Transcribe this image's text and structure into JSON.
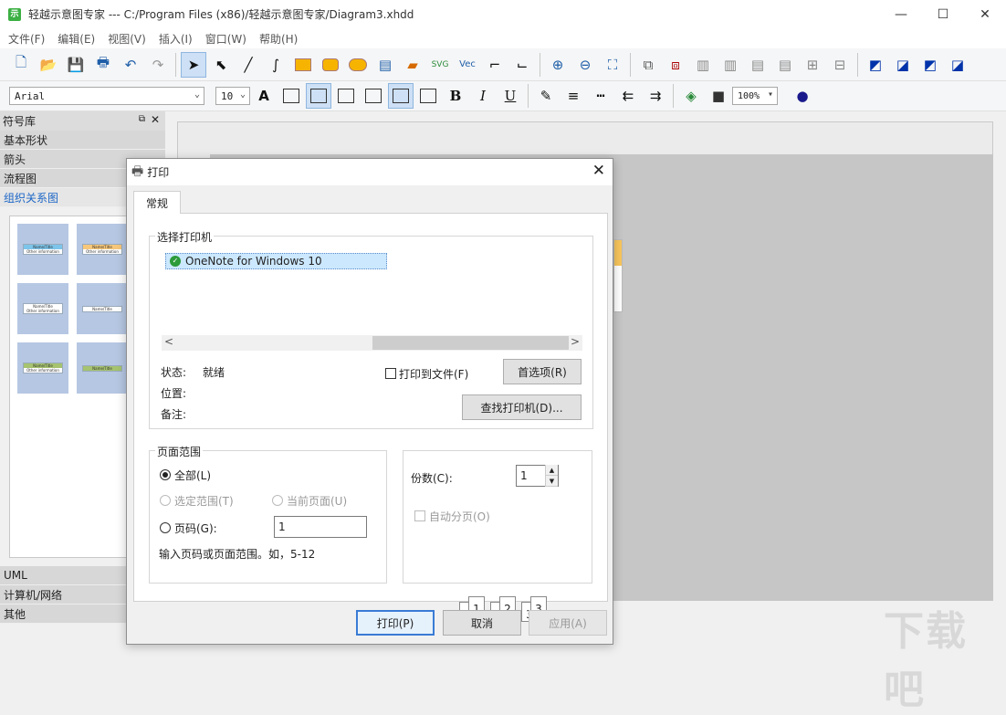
{
  "window": {
    "title": "轻越示意图专家 --- C:/Program Files (x86)/轻越示意图专家/Diagram3.xhdd",
    "minimize": "—",
    "maximize": "☐",
    "close": "✕"
  },
  "menu": [
    "文件(F)",
    "编辑(E)",
    "视图(V)",
    "插入(I)",
    "窗口(W)",
    "帮助(H)"
  ],
  "toolbar2": {
    "font": "Arial",
    "font_size": "10",
    "zoom": "100%",
    "bold": "B",
    "italic": "I",
    "underline": "U"
  },
  "leftpanel": {
    "title": "符号库",
    "categories": [
      "基本形状",
      "箭头",
      "流程图",
      "组织关系图"
    ],
    "bottom_categories": [
      "UML",
      "计算机/网络",
      "其他"
    ],
    "tile_labels": [
      "Name/Title",
      "Other information"
    ]
  },
  "dialog": {
    "title": "打印",
    "tab": "常规",
    "printer_group": "选择打印机",
    "printer_name": "OneNote for Windows 10",
    "status_label": "状态:",
    "status_value": "就绪",
    "location_label": "位置:",
    "comment_label": "备注:",
    "print_to_file": "打印到文件(F)",
    "preferences_button": "首选项(R)",
    "find_printer_button": "查找打印机(D)...",
    "page_range_group": "页面范围",
    "all": "全部(L)",
    "selection": "选定范围(T)",
    "current_page": "当前页面(U)",
    "pages": "页码(G):",
    "pages_value": "1",
    "pages_hint": "输入页码或页面范围。如，5-12",
    "copies_label": "份数(C):",
    "copies_value": "1",
    "collate": "自动分页(O)",
    "print_button": "打印(P)",
    "cancel_button": "取消",
    "apply_button": "应用(A)"
  },
  "watermark": "下载吧",
  "colors": {
    "accent": "#3a7bd5",
    "selection": "#cce8ff",
    "tile_bg": "#b6c7e3"
  }
}
